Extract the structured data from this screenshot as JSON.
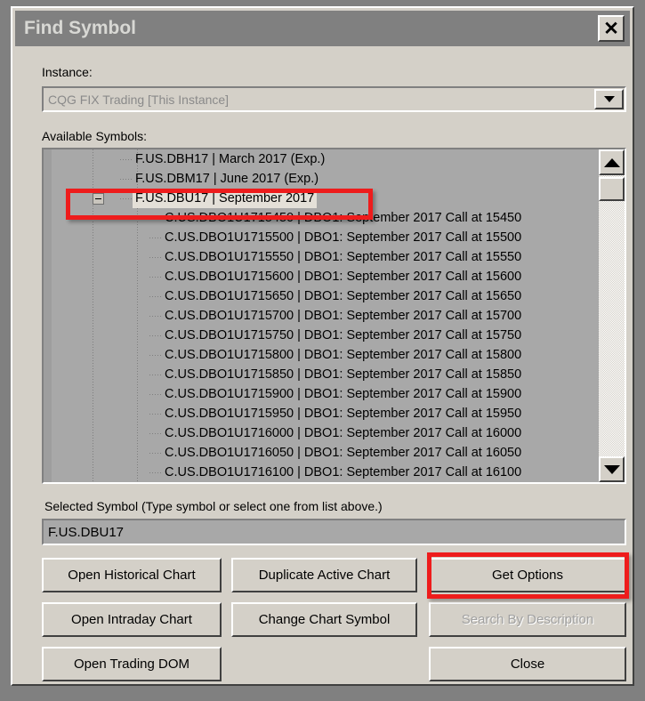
{
  "window": {
    "title": "Find Symbol",
    "close_icon": "close-x-icon"
  },
  "instance": {
    "label": "Instance:",
    "value": "CQG FIX Trading [This Instance]",
    "disabled": true,
    "dropdown_icon": "chevron-down-icon"
  },
  "available_symbols": {
    "label": "Available Symbols:",
    "rows": [
      {
        "level": 1,
        "symbol": "F.US.DBH17",
        "description": "March 2017 (Exp.)",
        "text": "F.US.DBH17  |  March 2017 (Exp.)",
        "selected": false,
        "expander": null
      },
      {
        "level": 1,
        "symbol": "F.US.DBM17",
        "description": "June 2017 (Exp.)",
        "text": "F.US.DBM17  |  June 2017 (Exp.)",
        "selected": false,
        "expander": null
      },
      {
        "level": 1,
        "symbol": "F.US.DBU17",
        "description": "September 2017",
        "text": "F.US.DBU17  |  September 2017",
        "selected": true,
        "expander": "minus"
      },
      {
        "level": 2,
        "symbol": "C.US.DBO1U1715450",
        "description": "DBO1: September 2017 Call at 15450",
        "text": "C.US.DBO1U1715450  |  DBO1: September 2017 Call at 15450",
        "selected": false,
        "expander": null
      },
      {
        "level": 2,
        "symbol": "C.US.DBO1U1715500",
        "description": "DBO1: September 2017 Call at 15500",
        "text": "C.US.DBO1U1715500  |  DBO1: September 2017 Call at 15500",
        "selected": false,
        "expander": null
      },
      {
        "level": 2,
        "symbol": "C.US.DBO1U1715550",
        "description": "DBO1: September 2017 Call at 15550",
        "text": "C.US.DBO1U1715550  |  DBO1: September 2017 Call at 15550",
        "selected": false,
        "expander": null
      },
      {
        "level": 2,
        "symbol": "C.US.DBO1U1715600",
        "description": "DBO1: September 2017 Call at 15600",
        "text": "C.US.DBO1U1715600  |  DBO1: September 2017 Call at 15600",
        "selected": false,
        "expander": null
      },
      {
        "level": 2,
        "symbol": "C.US.DBO1U1715650",
        "description": "DBO1: September 2017 Call at 15650",
        "text": "C.US.DBO1U1715650  |  DBO1: September 2017 Call at 15650",
        "selected": false,
        "expander": null
      },
      {
        "level": 2,
        "symbol": "C.US.DBO1U1715700",
        "description": "DBO1: September 2017 Call at 15700",
        "text": "C.US.DBO1U1715700  |  DBO1: September 2017 Call at 15700",
        "selected": false,
        "expander": null
      },
      {
        "level": 2,
        "symbol": "C.US.DBO1U1715750",
        "description": "DBO1: September 2017 Call at 15750",
        "text": "C.US.DBO1U1715750  |  DBO1: September 2017 Call at 15750",
        "selected": false,
        "expander": null
      },
      {
        "level": 2,
        "symbol": "C.US.DBO1U1715800",
        "description": "DBO1: September 2017 Call at 15800",
        "text": "C.US.DBO1U1715800  |  DBO1: September 2017 Call at 15800",
        "selected": false,
        "expander": null
      },
      {
        "level": 2,
        "symbol": "C.US.DBO1U1715850",
        "description": "DBO1: September 2017 Call at 15850",
        "text": "C.US.DBO1U1715850  |  DBO1: September 2017 Call at 15850",
        "selected": false,
        "expander": null
      },
      {
        "level": 2,
        "symbol": "C.US.DBO1U1715900",
        "description": "DBO1: September 2017 Call at 15900",
        "text": "C.US.DBO1U1715900  |  DBO1: September 2017 Call at 15900",
        "selected": false,
        "expander": null
      },
      {
        "level": 2,
        "symbol": "C.US.DBO1U1715950",
        "description": "DBO1: September 2017 Call at 15950",
        "text": "C.US.DBO1U1715950  |  DBO1: September 2017 Call at 15950",
        "selected": false,
        "expander": null
      },
      {
        "level": 2,
        "symbol": "C.US.DBO1U1716000",
        "description": "DBO1: September 2017 Call at 16000",
        "text": "C.US.DBO1U1716000  |  DBO1: September 2017 Call at 16000",
        "selected": false,
        "expander": null
      },
      {
        "level": 2,
        "symbol": "C.US.DBO1U1716050",
        "description": "DBO1: September 2017 Call at 16050",
        "text": "C.US.DBO1U1716050  |  DBO1: September 2017 Call at 16050",
        "selected": false,
        "expander": null
      },
      {
        "level": 2,
        "symbol": "C.US.DBO1U1716100",
        "description": "DBO1: September 2017 Call at 16100",
        "text": "C.US.DBO1U1716100  |  DBO1: September 2017 Call at 16100",
        "selected": false,
        "expander": null
      }
    ],
    "scrollbar": {
      "up_icon": "arrow-up-icon",
      "down_icon": "arrow-down-icon"
    }
  },
  "selected_symbol": {
    "label": "Selected Symbol (Type symbol or select one from list above.)",
    "value": "F.US.DBU17",
    "placeholder": ""
  },
  "buttons": {
    "open_historical_chart": "Open Historical Chart",
    "duplicate_active_chart": "Duplicate Active Chart",
    "get_options": "Get Options",
    "open_intraday_chart": "Open Intraday Chart",
    "change_chart_symbol": "Change Chart Symbol",
    "search_by_description": "Search By Description",
    "open_trading_dom": "Open Trading DOM",
    "close": "Close"
  },
  "annotations": {
    "highlight_color": "#ee1c1c",
    "boxes": [
      {
        "target": "F.US.DBU17  |  September 2017"
      },
      {
        "target": "Get Options"
      }
    ]
  },
  "colors": {
    "dialog_face": "#d4d0c8",
    "titlebar": "#808080",
    "list_background": "#a8a8a8",
    "selection_background": "#e4e0d8",
    "annotation_red": "#ee1c1c",
    "disabled_text": "#a0a0a0"
  }
}
